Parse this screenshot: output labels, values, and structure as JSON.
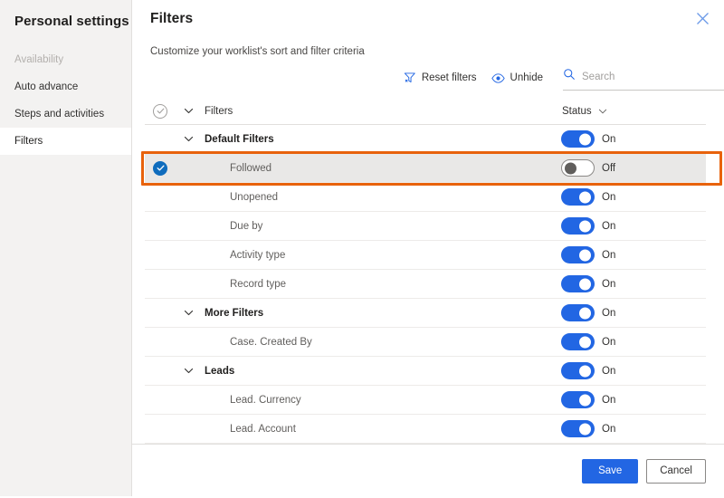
{
  "sidebar": {
    "title": "Personal settings",
    "items": [
      {
        "label": "Availability",
        "state": "disabled"
      },
      {
        "label": "Auto advance",
        "state": "normal"
      },
      {
        "label": "Steps and activities",
        "state": "normal"
      },
      {
        "label": "Filters",
        "state": "active"
      }
    ]
  },
  "panel": {
    "title": "Filters",
    "subtitle": "Customize your worklist's sort and filter criteria",
    "close_icon": "close-icon"
  },
  "toolbar": {
    "reset_filters_label": "Reset filters",
    "reset_filters_icon": "filter-clear-icon",
    "unhide_label": "Unhide",
    "unhide_icon": "eye-icon",
    "search_icon": "search-icon",
    "search_placeholder": "Search",
    "search_value": ""
  },
  "table": {
    "header": {
      "select_icon": "check-circle-outline-icon",
      "chevron_icon": "chevron-down-icon",
      "name_column": "Filters",
      "status_column": "Status",
      "status_chevron_icon": "chevron-down-icon"
    },
    "rows": [
      {
        "label": "Default Filters",
        "type": "group",
        "indent": 1,
        "expanded": true,
        "status": "On",
        "toggle": "on",
        "selected": false
      },
      {
        "label": "Followed",
        "type": "item",
        "indent": 2,
        "expanded": false,
        "status": "Off",
        "toggle": "off",
        "selected": true
      },
      {
        "label": "Unopened",
        "type": "item",
        "indent": 2,
        "expanded": false,
        "status": "On",
        "toggle": "on",
        "selected": false
      },
      {
        "label": "Due by",
        "type": "item",
        "indent": 2,
        "expanded": false,
        "status": "On",
        "toggle": "on",
        "selected": false
      },
      {
        "label": "Activity type",
        "type": "item",
        "indent": 2,
        "expanded": false,
        "status": "On",
        "toggle": "on",
        "selected": false
      },
      {
        "label": "Record type",
        "type": "item",
        "indent": 2,
        "expanded": false,
        "status": "On",
        "toggle": "on",
        "selected": false
      },
      {
        "label": "More Filters",
        "type": "group",
        "indent": 1,
        "expanded": true,
        "status": "On",
        "toggle": "on",
        "selected": false
      },
      {
        "label": "Case. Created By",
        "type": "item",
        "indent": 2,
        "expanded": false,
        "status": "On",
        "toggle": "on",
        "selected": false
      },
      {
        "label": "Leads",
        "type": "group",
        "indent": 1,
        "expanded": true,
        "status": "On",
        "toggle": "on",
        "selected": false
      },
      {
        "label": "Lead. Currency",
        "type": "item",
        "indent": 2,
        "expanded": false,
        "status": "On",
        "toggle": "on",
        "selected": false
      },
      {
        "label": "Lead. Account",
        "type": "item",
        "indent": 2,
        "expanded": false,
        "status": "On",
        "toggle": "on",
        "selected": false
      }
    ]
  },
  "footer": {
    "save_label": "Save",
    "cancel_label": "Cancel"
  },
  "colors": {
    "accent_blue": "#2266e3",
    "toggle_on": "#2266e3",
    "highlight_orange": "#e8620c",
    "sidebar_bg": "#f3f2f1",
    "selected_row_bg": "#e9e8e7",
    "check_blue": "#0f6cbd"
  }
}
